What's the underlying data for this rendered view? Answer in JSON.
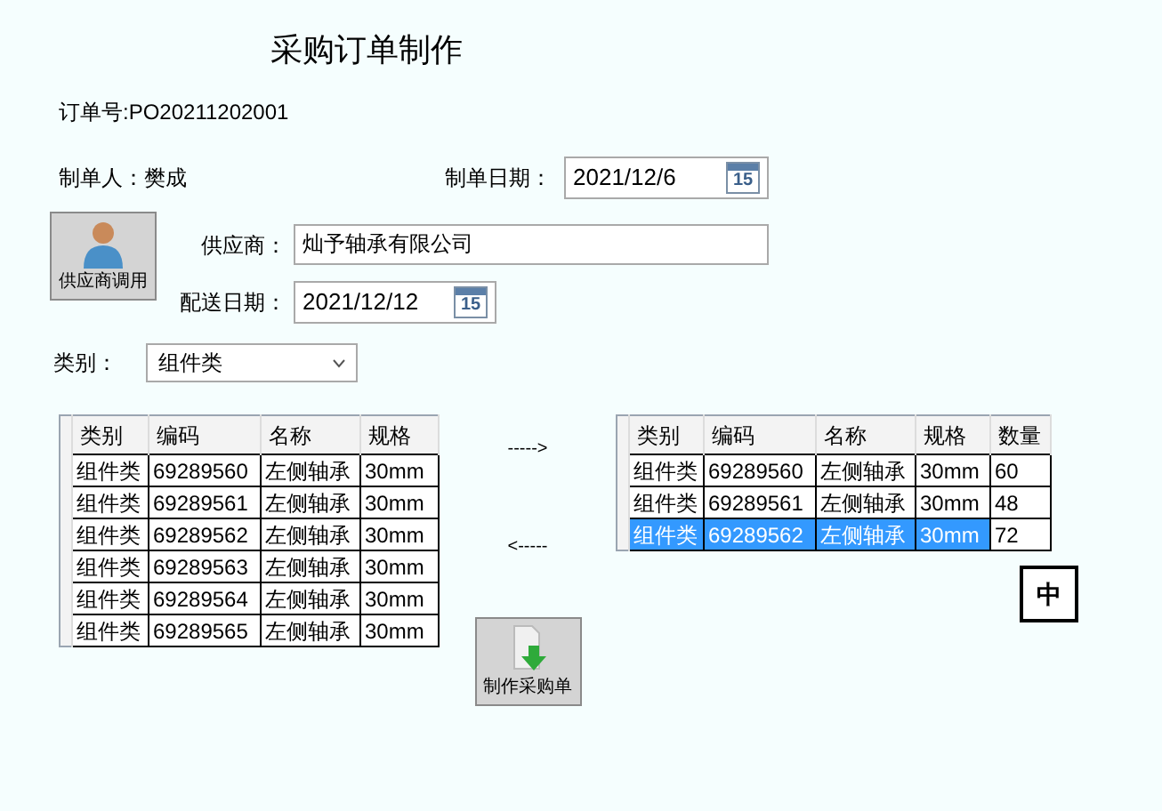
{
  "title": "采购订单制作",
  "order_no": "订单号:PO20211202001",
  "maker": "制单人：樊成",
  "make_date": {
    "label": "制单日期：",
    "value": "2021/12/6",
    "icon_text": "15"
  },
  "supplier_button": "供应商调用",
  "supplier": {
    "label": "供应商：",
    "value": "灿予轴承有限公司"
  },
  "delivery_date": {
    "label": "配送日期：",
    "value": "2021/12/12",
    "icon_text": "15"
  },
  "category": {
    "label": "类别：",
    "value": "组件类"
  },
  "left_table": {
    "columns": [
      "类别",
      "编码",
      "名称",
      "规格"
    ],
    "rows": [
      {
        "cells": [
          "组件类",
          "69289560",
          "左侧轴承",
          "30mm"
        ]
      },
      {
        "cells": [
          "组件类",
          "69289561",
          "左侧轴承",
          "30mm"
        ]
      },
      {
        "cells": [
          "组件类",
          "69289562",
          "左侧轴承",
          "30mm"
        ]
      },
      {
        "cells": [
          "组件类",
          "69289563",
          "左侧轴承",
          "30mm"
        ]
      },
      {
        "cells": [
          "组件类",
          "69289564",
          "左侧轴承",
          "30mm"
        ]
      },
      {
        "cells": [
          "组件类",
          "69289565",
          "左侧轴承",
          "30mm"
        ]
      }
    ]
  },
  "add_arrow": "----->",
  "remove_arrow": "<-----",
  "make_button": "制作采购单",
  "right_table": {
    "columns": [
      "类别",
      "编码",
      "名称",
      "规格",
      "数量"
    ],
    "rows": [
      {
        "cells": [
          "组件类",
          "69289560",
          "左侧轴承",
          "30mm",
          "60"
        ],
        "selected": false
      },
      {
        "cells": [
          "组件类",
          "69289561",
          "左侧轴承",
          "30mm",
          "48"
        ],
        "selected": false
      },
      {
        "cells": [
          "组件类",
          "69289562",
          "左侧轴承",
          "30mm",
          "72"
        ],
        "selected": true
      }
    ]
  },
  "ime_indicator": "中"
}
